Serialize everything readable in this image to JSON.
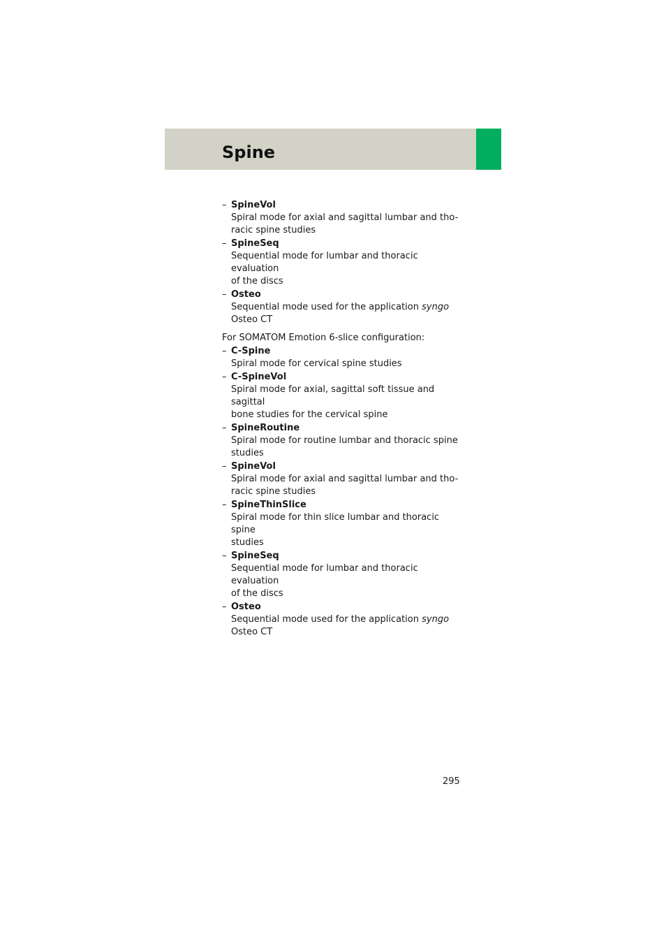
{
  "header": {
    "title": "Spine",
    "band_color": "#d2d2c6",
    "accent_color": "#00ae5f"
  },
  "section1": {
    "items": [
      {
        "term": "SpineVol",
        "desc": "Spiral mode for axial and sagittal lumbar and tho-racic spine studies",
        "line1": "Spiral mode for axial and sagittal lumbar and tho-",
        "line2": "racic spine studies"
      },
      {
        "term": "SpineSeq",
        "line1": "Sequential mode for lumbar and thoracic evaluation",
        "line2": "of the discs"
      },
      {
        "term": "Osteo",
        "line1_pre": "Sequential mode used for the application ",
        "line1_em": "syngo",
        "line2": "Osteo CT"
      }
    ]
  },
  "section2": {
    "intro": "For SOMATOM Emotion 6-slice configuration:",
    "items": [
      {
        "term": "C-Spine",
        "line1": "Spiral mode for cervical spine studies"
      },
      {
        "term": "C-SpineVol",
        "line1": "Spiral mode for axial, sagittal soft tissue and sagittal",
        "line2": "bone studies for the cervical spine"
      },
      {
        "term": "SpineRoutine",
        "line1": "Spiral mode for routine lumbar and thoracic spine",
        "line2": "studies"
      },
      {
        "term": "SpineVol",
        "line1": "Spiral mode for axial and sagittal lumbar and tho-",
        "line2": "racic spine studies"
      },
      {
        "term": "SpineThinSlice",
        "line1": "Spiral mode for thin slice lumbar and thoracic spine",
        "line2": "studies"
      },
      {
        "term": "SpineSeq",
        "line1": "Sequential mode for lumbar and thoracic evaluation",
        "line2": "of the discs"
      },
      {
        "term": "Osteo",
        "line1_pre": "Sequential mode used for the application ",
        "line1_em": "syngo",
        "line2": "Osteo CT"
      }
    ]
  },
  "dash": "–",
  "footer": {
    "page_number": "295"
  }
}
